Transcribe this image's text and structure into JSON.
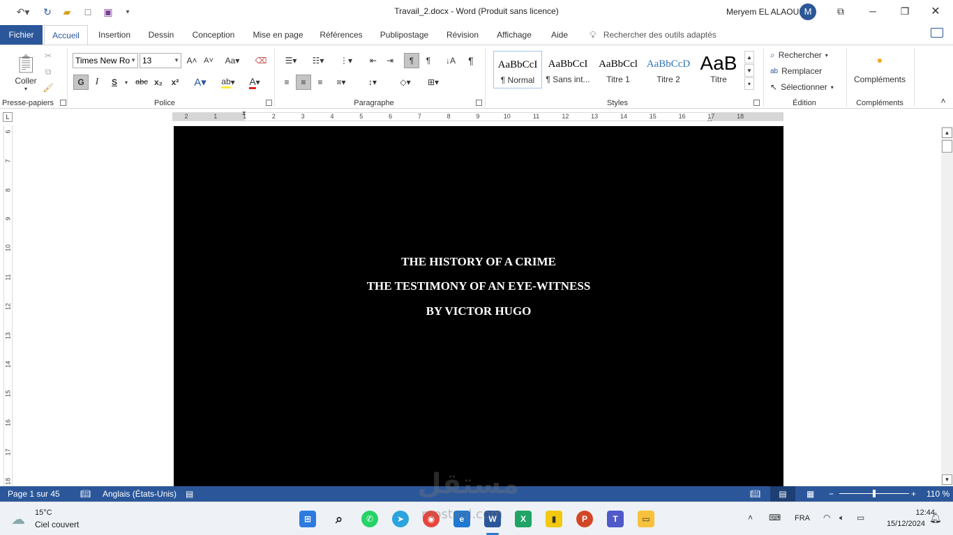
{
  "window": {
    "title": "Travail_2.docx  -  Word (Produit sans licence)",
    "user_name": "Meryem EL ALAOUI",
    "user_initial": "M"
  },
  "tabs": {
    "file": "Fichier",
    "items": [
      "Accueil",
      "Insertion",
      "Dessin",
      "Conception",
      "Mise en page",
      "Références",
      "Publipostage",
      "Révision",
      "Affichage",
      "Aide"
    ],
    "active": "Accueil",
    "search_placeholder": "Rechercher des outils adaptés"
  },
  "ribbon": {
    "clipboard": {
      "paste_label": "Coller",
      "group_label": "Presse-papiers"
    },
    "font": {
      "font_name": "Times New Ro",
      "font_size": "13",
      "group_label": "Police",
      "bold": "G",
      "italic": "I",
      "underline": "S",
      "strike": "abc",
      "subscript": "x₂",
      "superscript": "x²",
      "case": "Aa"
    },
    "paragraph": {
      "group_label": "Paragraphe"
    },
    "styles": {
      "group_label": "Styles",
      "items": [
        {
          "sample": "AaBbCcI",
          "name": "¶ Normal"
        },
        {
          "sample": "AaBbCcI",
          "name": "¶ Sans int..."
        },
        {
          "sample": "AaBbCcl",
          "name": "Titre 1"
        },
        {
          "sample": "AaBbCcD",
          "name": "Titre 2"
        },
        {
          "sample": "AaB",
          "name": "Titre"
        }
      ]
    },
    "editing": {
      "group_label": "Édition",
      "find": "Rechercher",
      "replace": "Remplacer",
      "select": "Sélectionner"
    },
    "addins": {
      "button": "Compléments",
      "group_label": "Compléments"
    }
  },
  "ruler": {
    "h_numbers": [
      "2",
      "1",
      "1",
      "2",
      "3",
      "4",
      "5",
      "6",
      "7",
      "8",
      "9",
      "10",
      "11",
      "12",
      "13",
      "14",
      "15",
      "16",
      "17",
      "18"
    ],
    "v_numbers": [
      "6",
      "7",
      "8",
      "9",
      "10",
      "11",
      "12",
      "13",
      "14",
      "15",
      "16",
      "17",
      "18"
    ]
  },
  "document": {
    "line1": "THE HISTORY OF A CRIME",
    "line2": "THE TESTIMONY OF AN EYE-WITNESS",
    "line3": "BY VICTOR HUGO"
  },
  "status": {
    "page": "Page 1 sur 45",
    "language": "Anglais (États-Unis)",
    "zoom": "110 %",
    "zoom_level_fraction": 0.5
  },
  "taskbar": {
    "temp": "15°C",
    "weather": "Ciel couvert",
    "lang": "FRA",
    "time": "12:44",
    "date": "15/12/2024"
  },
  "watermark": {
    "text": "مستقل",
    "sub": "mostaql.com"
  },
  "colors": {
    "accent": "#2b579a",
    "page": "#000000",
    "text_on_page": "#ffffff"
  }
}
